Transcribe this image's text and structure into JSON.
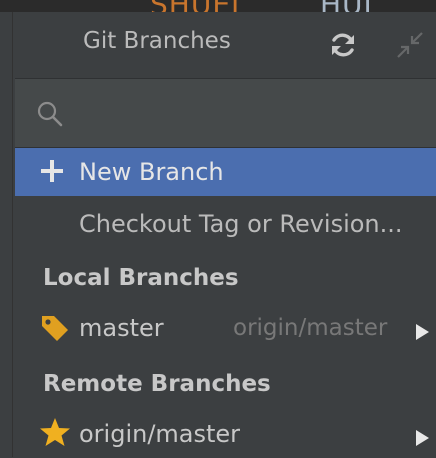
{
  "background_fragment": {
    "left": "SHUEI",
    "right": "HUI"
  },
  "popup": {
    "title": "Git Branches",
    "refresh_icon": "refresh-icon",
    "collapse_icon": "collapse-icon",
    "search": {
      "value": "",
      "placeholder": "",
      "icon": "search-icon"
    },
    "actions": [
      {
        "label": "New Branch",
        "icon": "plus-icon",
        "selected": true
      },
      {
        "label": "Checkout Tag or Revision...",
        "selected": false
      }
    ],
    "sections": {
      "local": {
        "heading": "Local Branches",
        "branches": [
          {
            "name": "master",
            "tracking": "origin/master",
            "icon": "tag-icon",
            "icon_color": "#e0a020"
          }
        ]
      },
      "remote": {
        "heading": "Remote Branches",
        "branches": [
          {
            "name": "origin/master",
            "icon": "star-icon",
            "icon_color": "#f0b020"
          }
        ]
      }
    }
  },
  "colors": {
    "popup_bg": "#3c3f41",
    "selection": "#4b6eaf",
    "text": "#bbbbbb",
    "muted_text": "#787878"
  }
}
